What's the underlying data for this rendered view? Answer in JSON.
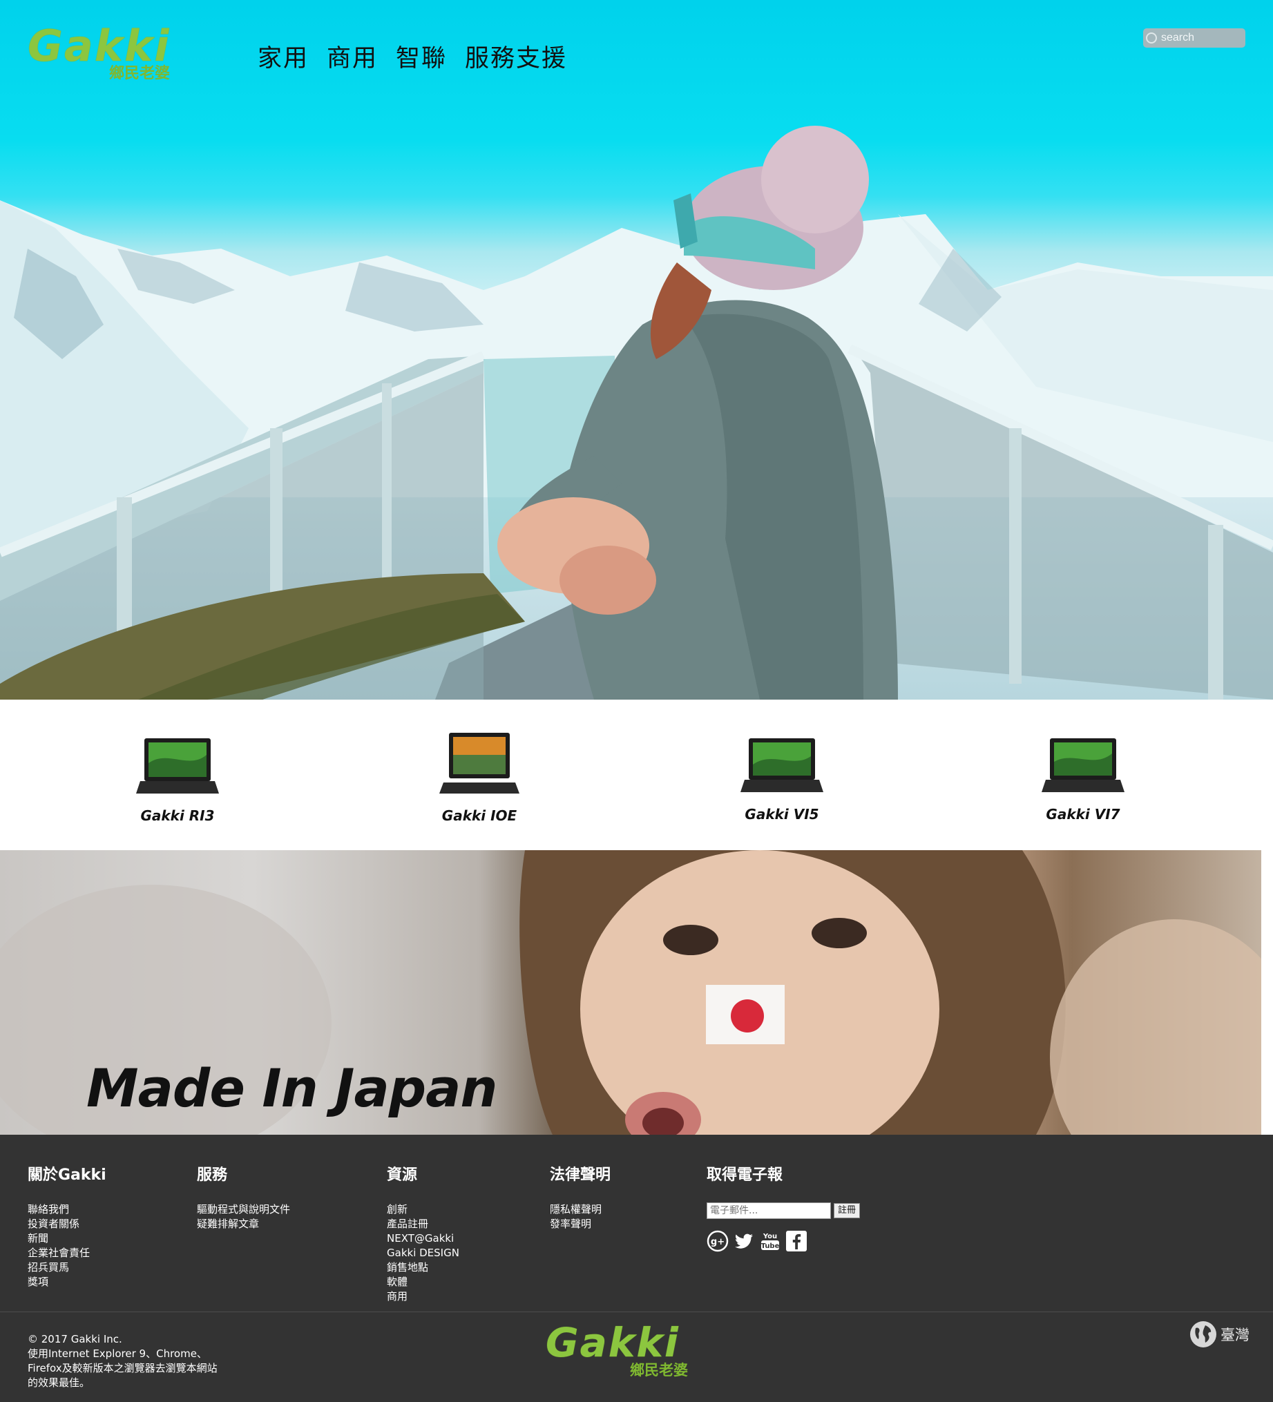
{
  "header": {
    "logo_text": "Gakki",
    "logo_subtext": "鄉民老婆",
    "nav": [
      "家用",
      "商用",
      "智聯",
      "服務支援"
    ],
    "search_placeholder": "search"
  },
  "products": [
    {
      "label": "Gakki RI3"
    },
    {
      "label": "Gakki IOE"
    },
    {
      "label": "Gakki VI5"
    },
    {
      "label": "Gakki VI7"
    }
  ],
  "banner": {
    "title": "Made In Japan"
  },
  "footer": {
    "columns": [
      {
        "title": "關於Gakki",
        "items": [
          "聯絡我們",
          "投資者關係",
          "新聞",
          "企業社會責任",
          "招兵買馬",
          "獎項"
        ]
      },
      {
        "title": "服務",
        "items": [
          "驅動程式與說明文件",
          "疑難排解文章"
        ]
      },
      {
        "title": "資源",
        "items": [
          "創新",
          "產品註冊",
          "NEXT@Gakki",
          "Gakki DESIGN",
          "銷售地點",
          "軟體",
          "商用"
        ]
      },
      {
        "title": "法律聲明",
        "items": [
          "隱私權聲明",
          "發率聲明"
        ]
      }
    ],
    "newsletter": {
      "title": "取得電子報",
      "placeholder": "電子郵件...",
      "button": "註冊"
    },
    "social": [
      "google-plus-icon",
      "twitter-icon",
      "youtube-icon",
      "facebook-icon"
    ],
    "legal": [
      "© 2017 Gakki Inc.",
      "使用Internet Explorer 9、Chrome、",
      "Firefox及較新版本之瀏覽器去瀏覽本網站",
      "的效果最佳。"
    ],
    "logo_text": "Gakki",
    "logo_subtext": "鄉民老婆",
    "region": "臺灣"
  },
  "colors": {
    "brand": "#8cc63f",
    "sky": "#00d2ec",
    "footer_bg": "#333333"
  }
}
